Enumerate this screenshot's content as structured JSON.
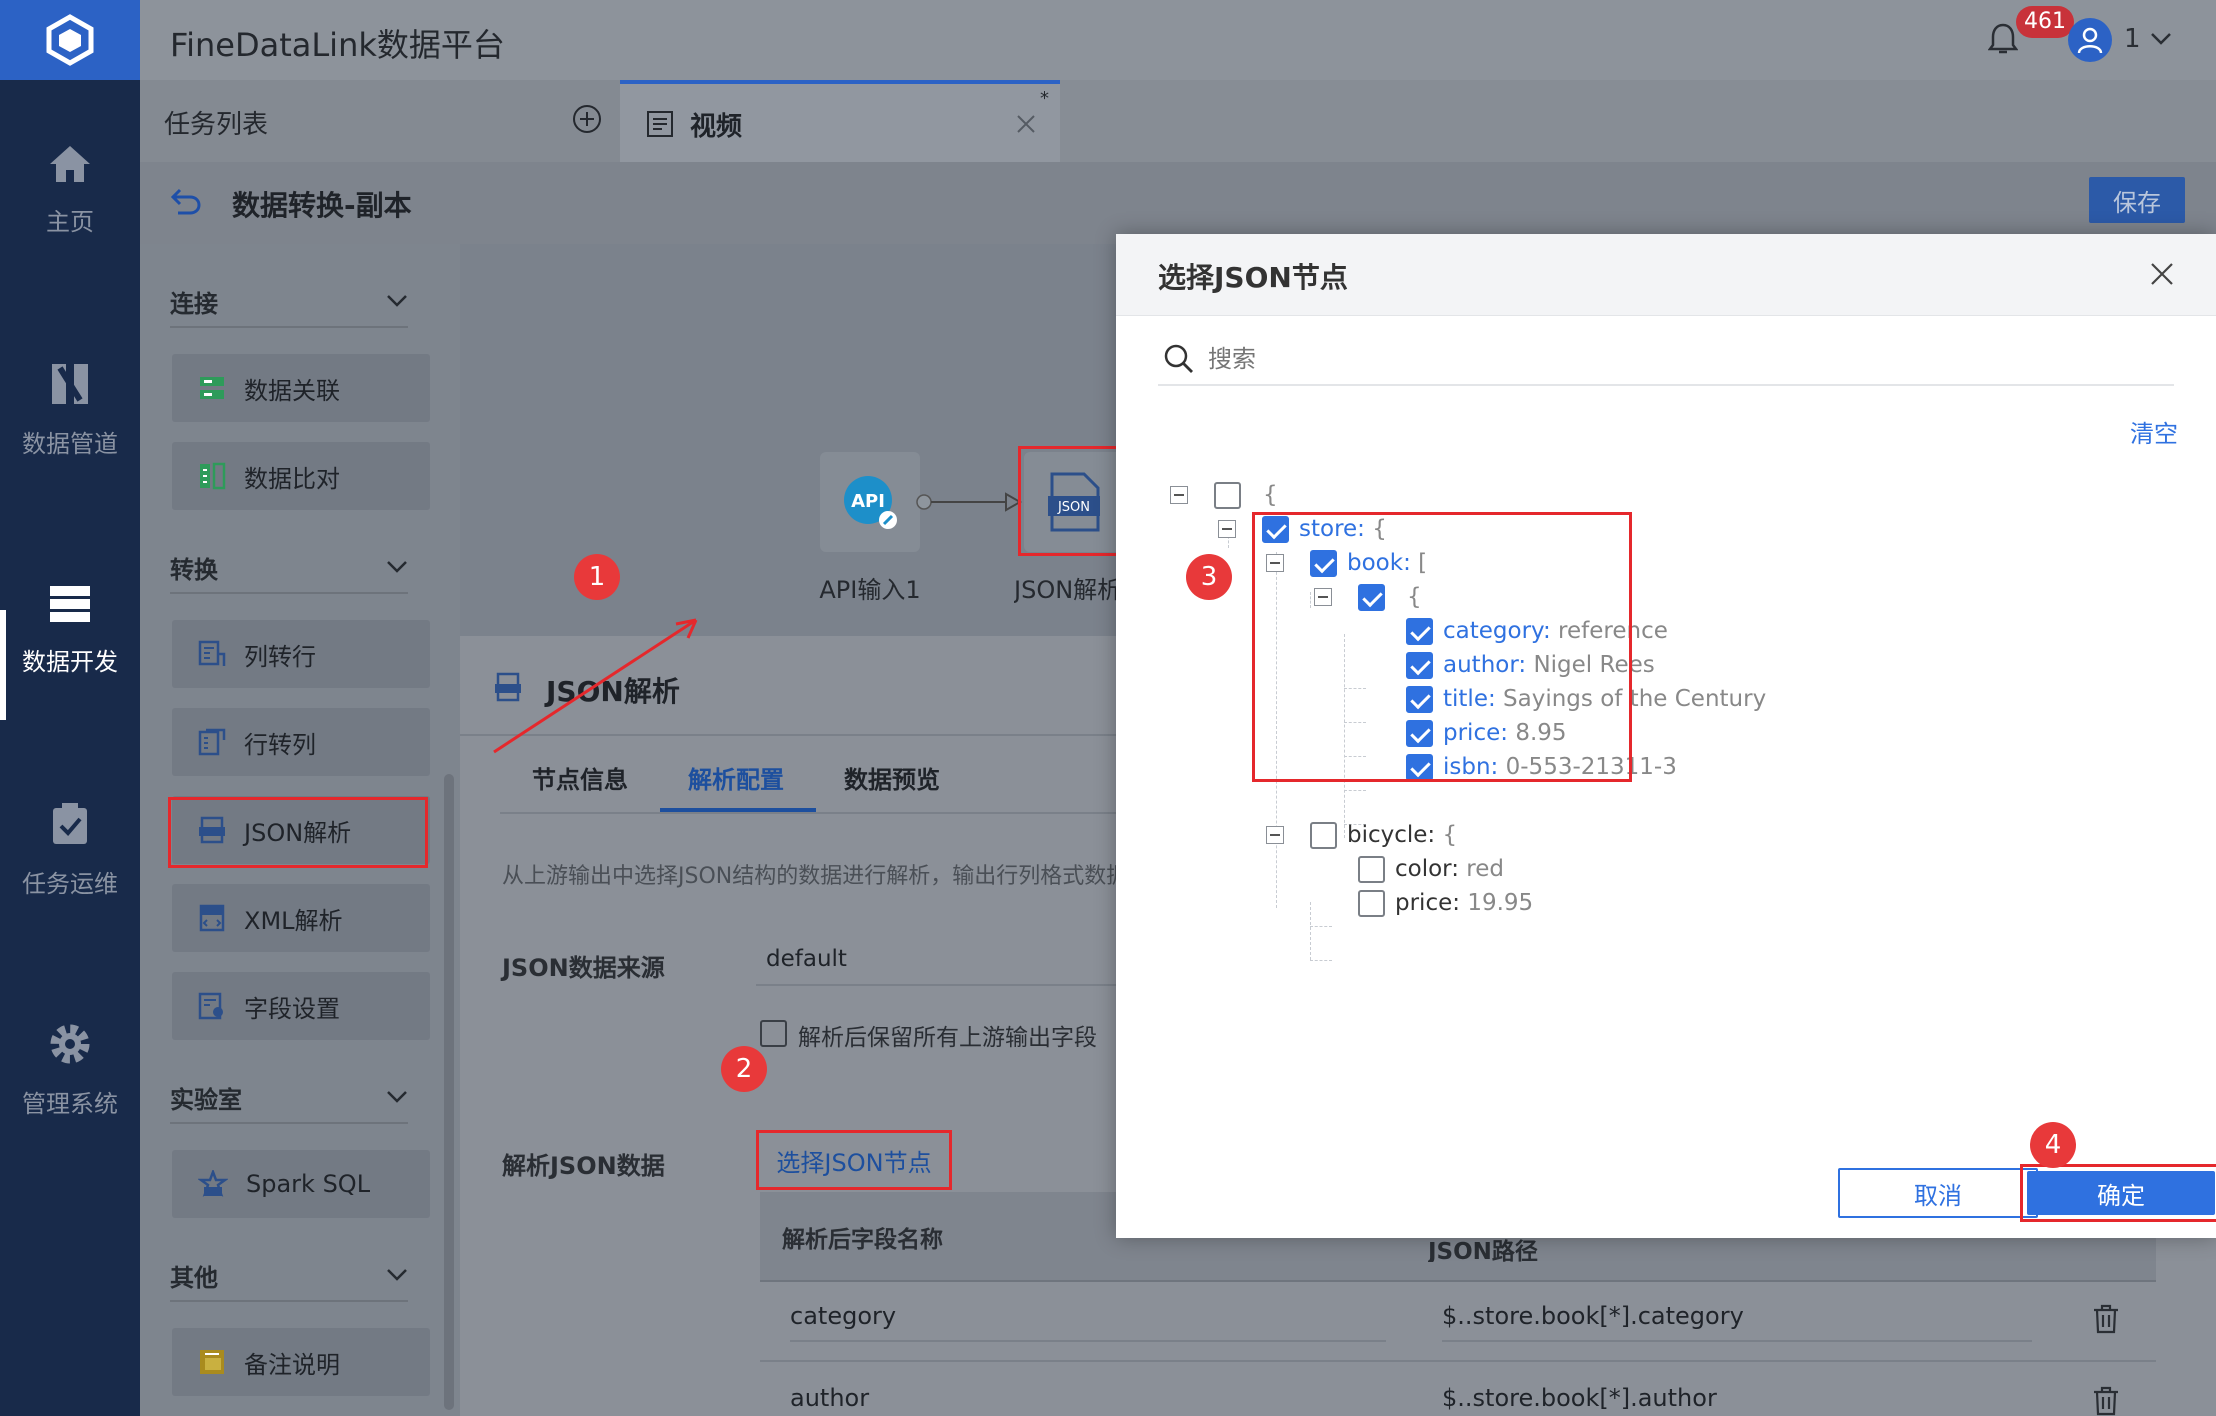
{
  "app": {
    "title": "FineDataLink数据平台",
    "notifications": "461",
    "user": "1"
  },
  "nav": [
    {
      "label": "主页"
    },
    {
      "label": "数据管道"
    },
    {
      "label": "数据开发"
    },
    {
      "label": "任务运维"
    },
    {
      "label": "管理系统"
    }
  ],
  "tabs": {
    "list_label": "任务列表",
    "active_tab": "视频",
    "unsaved_mark": "*"
  },
  "crumb": {
    "title": "数据转换-副本",
    "save_label": "保存"
  },
  "sidebar": {
    "groups": [
      {
        "label": "连接",
        "items": [
          {
            "label": "数据关联"
          },
          {
            "label": "数据比对"
          }
        ]
      },
      {
        "label": "转换",
        "items": [
          {
            "label": "列转行"
          },
          {
            "label": "行转列"
          },
          {
            "label": "JSON解析"
          },
          {
            "label": "XML解析"
          },
          {
            "label": "字段设置"
          }
        ]
      },
      {
        "label": "实验室",
        "items": [
          {
            "label": "Spark SQL"
          }
        ]
      },
      {
        "label": "其他",
        "items": [
          {
            "label": "备注说明"
          }
        ]
      }
    ]
  },
  "canvas": {
    "node1_label": "API输入1",
    "node1_icon": "API",
    "node2_label": "JSON解析",
    "node2_icon": "JSON"
  },
  "panel": {
    "title": "JSON解析",
    "tabs": [
      "节点信息",
      "解析配置",
      "数据预览"
    ],
    "description": "从上游输出中选择JSON结构的数据进行解析，输出行列格式数据",
    "source_label": "JSON数据来源",
    "source_value": "default",
    "keep_fields_label": "解析后保留所有上游输出字段",
    "parse_label": "解析JSON数据",
    "select_node_link": "选择JSON节点",
    "table": {
      "col1": "解析后字段名称",
      "col2": "JSON路径",
      "rows": [
        {
          "name": "category",
          "path": "$..store.book[*].category"
        },
        {
          "name": "author",
          "path": "$..store.book[*].author"
        }
      ]
    }
  },
  "modal": {
    "title": "选择JSON节点",
    "search_placeholder": "搜索",
    "clear_label": "清空",
    "cancel_label": "取消",
    "confirm_label": "确定",
    "tree": {
      "root": "{",
      "store": "store:",
      "store_open": "{",
      "book": "book:",
      "book_open": "[",
      "item_open": "{",
      "fields": [
        {
          "key": "category:",
          "value": "reference"
        },
        {
          "key": "author:",
          "value": "Nigel Rees"
        },
        {
          "key": "title:",
          "value": "Sayings of the Century"
        },
        {
          "key": "price:",
          "value": "8.95"
        },
        {
          "key": "isbn:",
          "value": "0-553-21311-3"
        }
      ],
      "bicycle": "bicycle:",
      "bicycle_open": "{",
      "bicycle_fields": [
        {
          "key": "color:",
          "value": "red"
        },
        {
          "key": "price:",
          "value": "19.95"
        }
      ]
    }
  },
  "steps": [
    "1",
    "2",
    "3",
    "4"
  ]
}
